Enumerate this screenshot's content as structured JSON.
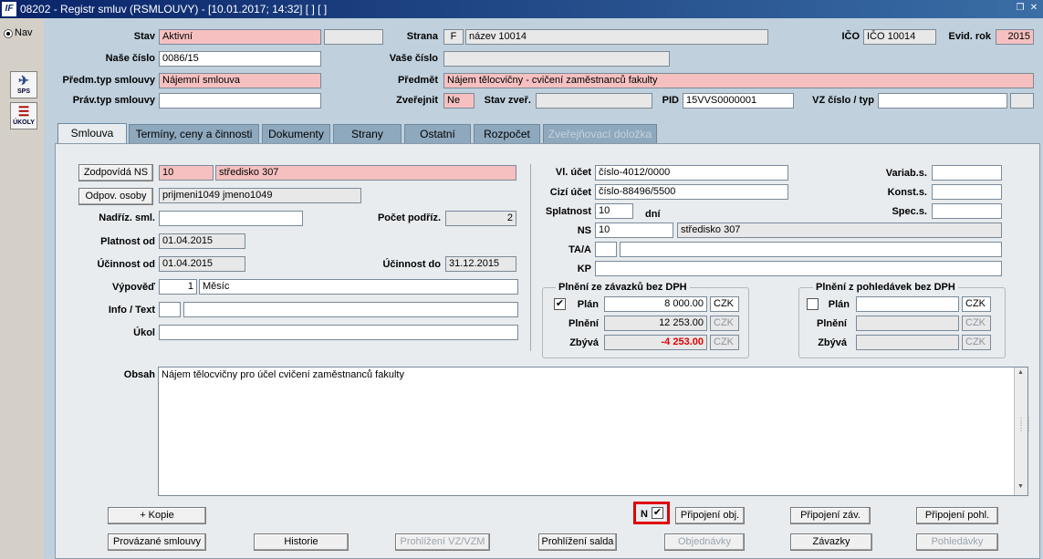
{
  "window": {
    "title": "08202 - Registr smluv (RSMLOUVY) - [10.01.2017; 14:32] [ ] [ ]",
    "app_icon": "IF"
  },
  "left": {
    "nav_label": "Nav",
    "sps_label": "SPS",
    "ukoly_label": "ÚKOLY"
  },
  "header": {
    "stav_label": "Stav",
    "stav_value": "Aktivní",
    "stav_extra": "",
    "strana_label": "Strana",
    "strana_code": "F",
    "strana_name": "název 10014",
    "ico_label": "IČO",
    "ico_value": "IČO 10014",
    "evid_rok_label": "Evid. rok",
    "evid_rok_value": "2015",
    "nase_cislo_label": "Naše číslo",
    "nase_cislo_value": "0086/15",
    "vase_cislo_label": "Vaše číslo",
    "vase_cislo_value": "",
    "predm_typ_label": "Předm.typ smlouvy",
    "predm_typ_value": "Nájemní smlouva",
    "predmet_label": "Předmět",
    "predmet_value": "Nájem tělocvičny - cvičení zaměstnanců fakulty",
    "prav_typ_label": "Práv.typ smlouvy",
    "prav_typ_value": "",
    "zverejnit_label": "Zveřejnit",
    "zverejnit_value": "Ne",
    "stav_zver_label": "Stav zveř.",
    "stav_zver_value": "",
    "pid_label": "PID",
    "pid_value": "15VVS0000001",
    "vz_label": "VZ číslo / typ",
    "vz_value": "",
    "vz_type": ""
  },
  "tabs": [
    {
      "label": "Smlouva"
    },
    {
      "label": "Termíny, ceny a činnosti"
    },
    {
      "label": "Dokumenty"
    },
    {
      "label": "Strany"
    },
    {
      "label": "Ostatní"
    },
    {
      "label": "Rozpočet"
    },
    {
      "label": "Zveřejňovací doložka"
    }
  ],
  "form": {
    "zodpovida_btn": "Zodpovídá NS",
    "zodpovida_code": "10",
    "zodpovida_name": "středisko 307",
    "odpov_btn": "Odpov. osoby",
    "odpov_value": "prijmeni1049 jmeno1049",
    "nadriz_label": "Nadříz. sml.",
    "nadriz_value": "",
    "pocet_label": "Počet podříz.",
    "pocet_value": "2",
    "platnost_label": "Platnost od",
    "platnost_value": "01.04.2015",
    "ucinnost_od_label": "Účinnost od",
    "ucinnost_od_value": "01.04.2015",
    "ucinnost_do_label": "Účinnost do",
    "ucinnost_do_value": "31.12.2015",
    "vypoved_label": "Výpověď",
    "vypoved_num": "1",
    "vypoved_unit": "Měsíc",
    "info_label": "Info / Text",
    "info_a": "",
    "info_b": "",
    "ukol_label": "Úkol",
    "ukol_value": "",
    "vl_ucet_label": "Vl. účet",
    "vl_ucet_value": "číslo-4012/0000",
    "cizi_ucet_label": "Cizí účet",
    "cizi_ucet_value": "číslo-88496/5500",
    "splatnost_label": "Splatnost",
    "splatnost_value": "10",
    "splatnost_unit": "dní",
    "ns_label": "NS",
    "ns_code": "10",
    "ns_name": "středisko 307",
    "taa_label": "TA/A",
    "taa_a": "",
    "taa_b": "",
    "kp_label": "KP",
    "kp_value": "",
    "variab_label": "Variab.s.",
    "variab_value": "",
    "konst_label": "Konst.s.",
    "konst_value": "",
    "spec_label": "Spec.s.",
    "spec_value": "",
    "zavazky_group": {
      "title": "Plnění ze závazků bez DPH",
      "plan_label": "Plán",
      "plan_checked": "✔",
      "plan_value": "8 000.00",
      "plan_cur": "CZK",
      "plneni_label": "Plnění",
      "plneni_value": "12 253.00",
      "plneni_cur": "CZK",
      "zbyva_label": "Zbývá",
      "zbyva_value": "-4 253.00",
      "zbyva_cur": "CZK"
    },
    "pohledavky_group": {
      "title": "Plnění z pohledávek bez DPH",
      "plan_label": "Plán",
      "plan_checked": "",
      "plan_value": "",
      "plan_cur": "CZK",
      "plneni_label": "Plnění",
      "plneni_value": "",
      "plneni_cur": "CZK",
      "zbyva_label": "Zbývá",
      "zbyva_value": "",
      "zbyva_cur": "CZK"
    },
    "obsah_label": "Obsah",
    "obsah_value": "Nájem tělocvičny pro účel cvičení zaměstnanců fakulty"
  },
  "buttons": {
    "kopie": "+ Kopie",
    "n_label": "N",
    "n_checked": "✔",
    "pripojeni_obj": "Připojení obj.",
    "pripojeni_zav": "Připojení záv.",
    "pripojeni_pohl": "Připojení pohl.",
    "provazane": "Provázané smlouvy",
    "historie": "Historie",
    "prohlizeni_vz": "Prohlížení VZ/VZM",
    "prohlizeni_salda": "Prohlížení salda",
    "objednavky": "Objednávky",
    "zavazky": "Závazky",
    "pohledavky": "Pohledávky"
  },
  "colors": {
    "title_bg": "#0a246a",
    "required_bg": "#f6c0c0",
    "tab_bg": "#8ea8bd",
    "panel_bg": "#e8ecef",
    "highlight": "#e00000"
  }
}
